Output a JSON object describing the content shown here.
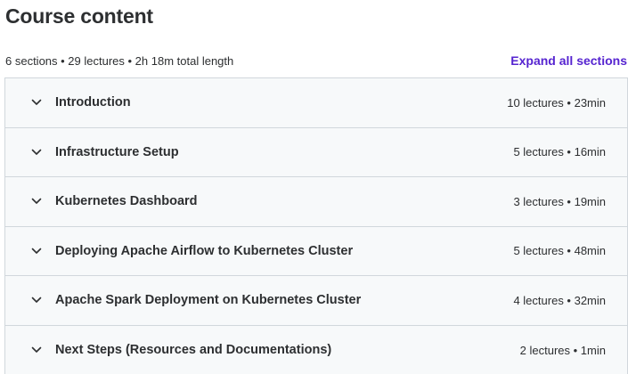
{
  "header": {
    "title": "Course content",
    "summary": "6 sections • 29 lectures • 2h 18m total length",
    "expand_label": "Expand all sections"
  },
  "colors": {
    "link": "#5624d0",
    "section_bg": "#f7f9fa",
    "border": "#d1d7dc",
    "text": "#2d2f31"
  },
  "sections": [
    {
      "title": "Introduction",
      "meta": "10 lectures • 23min",
      "icon": "chevron-down-icon"
    },
    {
      "title": "Infrastructure Setup",
      "meta": "5 lectures • 16min",
      "icon": "chevron-down-icon"
    },
    {
      "title": "Kubernetes Dashboard",
      "meta": "3 lectures • 19min",
      "icon": "chevron-down-icon"
    },
    {
      "title": "Deploying Apache Airflow to Kubernetes Cluster",
      "meta": "5 lectures • 48min",
      "icon": "chevron-down-icon"
    },
    {
      "title": "Apache Spark Deployment on Kubernetes Cluster",
      "meta": "4 lectures • 32min",
      "icon": "chevron-down-icon"
    },
    {
      "title": "Next Steps (Resources and Documentations)",
      "meta": "2 lectures • 1min",
      "icon": "chevron-down-icon"
    }
  ]
}
